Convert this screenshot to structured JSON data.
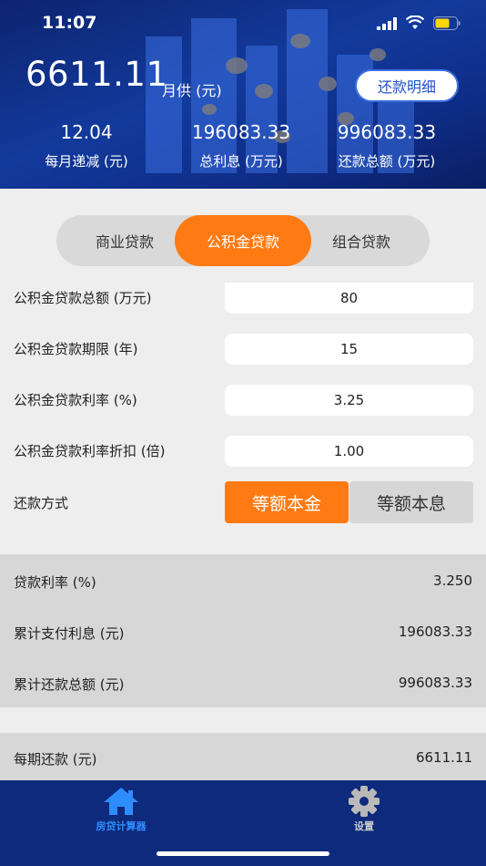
{
  "status": {
    "time": "11:07"
  },
  "header": {
    "monthly_payment": "6611.11",
    "monthly_payment_unit": "月供 (元)",
    "detail_button": "还款明细",
    "stats": [
      {
        "value": "12.04",
        "label": "每月递减 (元)"
      },
      {
        "value": "196083.33",
        "label": "总利息 (万元)"
      },
      {
        "value": "996083.33",
        "label": "还款总额 (万元)"
      }
    ]
  },
  "tabs": [
    {
      "label": "商业贷款",
      "active": false
    },
    {
      "label": "公积金贷款",
      "active": true
    },
    {
      "label": "组合贷款",
      "active": false
    }
  ],
  "form": {
    "amount": {
      "label": "公积金贷款总额 (万元)",
      "value": "80"
    },
    "term": {
      "label": "公积金贷款期限 (年)",
      "value": "15"
    },
    "rate": {
      "label": "公积金贷款利率 (%)",
      "value": "3.25"
    },
    "discount": {
      "label": "公积金贷款利率折扣 (倍)",
      "value": "1.00"
    },
    "method": {
      "label": "还款方式",
      "options": [
        "等额本金",
        "等额本息"
      ],
      "selected": "等额本金"
    }
  },
  "results": [
    {
      "label": "贷款利率 (%)",
      "value": "3.250"
    },
    {
      "label": "累计支付利息 (元)",
      "value": "196083.33"
    },
    {
      "label": "累计还款总额 (元)",
      "value": "996083.33"
    }
  ],
  "results2": [
    {
      "label": "每期还款 (元)",
      "value": "6611.11"
    }
  ],
  "tabbar": [
    {
      "label": "房贷计算器",
      "icon": "home-icon",
      "active": true
    },
    {
      "label": "设置",
      "icon": "gear-icon",
      "active": false
    }
  ],
  "colors": {
    "accent": "#ff7a12",
    "header": "#123a9c",
    "tabbar": "#0e2a7d",
    "active_tab": "#2f8cff"
  }
}
